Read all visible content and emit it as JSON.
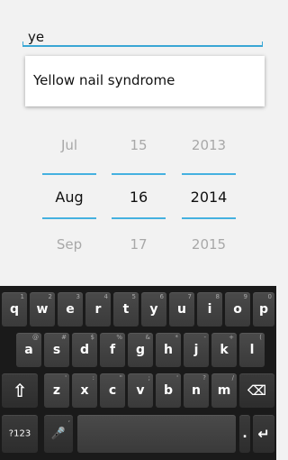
{
  "search": {
    "value": "ye"
  },
  "suggestions": [
    "Yellow nail syndrome"
  ],
  "date_picker": {
    "month": {
      "prev": "Jul",
      "current": "Aug",
      "next": "Sep"
    },
    "day": {
      "prev": "15",
      "current": "16",
      "next": "17"
    },
    "year": {
      "prev": "2013",
      "current": "2014",
      "next": "2015"
    }
  },
  "keyboard": {
    "row1": [
      {
        "k": "q",
        "h": "1"
      },
      {
        "k": "w",
        "h": "2"
      },
      {
        "k": "e",
        "h": "3"
      },
      {
        "k": "r",
        "h": "4"
      },
      {
        "k": "t",
        "h": "5"
      },
      {
        "k": "y",
        "h": "6"
      },
      {
        "k": "u",
        "h": "7"
      },
      {
        "k": "i",
        "h": "8"
      },
      {
        "k": "o",
        "h": "9"
      },
      {
        "k": "p",
        "h": "0"
      }
    ],
    "row2": [
      {
        "k": "a",
        "h": "@"
      },
      {
        "k": "s",
        "h": "#"
      },
      {
        "k": "d",
        "h": "$"
      },
      {
        "k": "f",
        "h": "%"
      },
      {
        "k": "g",
        "h": "&"
      },
      {
        "k": "h",
        "h": "*"
      },
      {
        "k": "j",
        "h": "-"
      },
      {
        "k": "k",
        "h": "+"
      },
      {
        "k": "l",
        "h": "("
      }
    ],
    "row3": [
      {
        "k": "z",
        "h": "'"
      },
      {
        "k": "x",
        "h": ":"
      },
      {
        "k": "c",
        "h": "\""
      },
      {
        "k": "v",
        "h": ";"
      },
      {
        "k": "b",
        "h": "'"
      },
      {
        "k": "n",
        "h": "?"
      },
      {
        "k": "m",
        "h": "/"
      }
    ],
    "shift_icon": "⇧",
    "backspace_icon": "⌫",
    "symbols_label": "?123",
    "mic_icon": "🎤",
    "period_label": ".",
    "enter_icon": "↵",
    "comma_hint": ","
  },
  "colors": {
    "accent": "#45b1e0",
    "keyboard_bg": "#1a1a1a"
  }
}
